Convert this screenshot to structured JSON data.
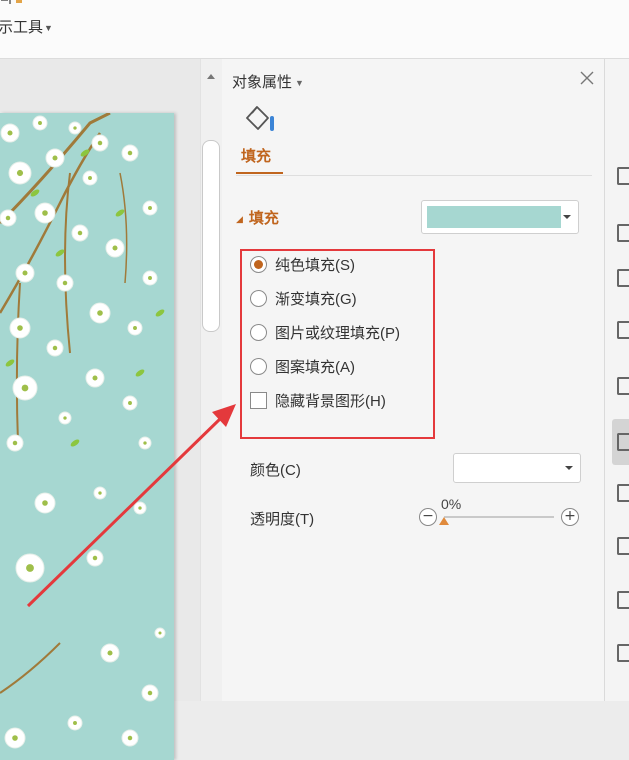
{
  "ribbon": {
    "tool_label": "示工具"
  },
  "panel": {
    "title": "对象属性",
    "tab_label": "填充",
    "section_label": "填充",
    "fill_color": "#a6d7d1",
    "fill_options": [
      {
        "label": "纯色填充(S)",
        "type": "radio",
        "selected": true
      },
      {
        "label": "渐变填充(G)",
        "type": "radio",
        "selected": false
      },
      {
        "label": "图片或纹理填充(P)",
        "type": "radio",
        "selected": false
      },
      {
        "label": "图案填充(A)",
        "type": "radio",
        "selected": false
      },
      {
        "label": "隐藏背景图形(H)",
        "type": "checkbox",
        "checked": false
      }
    ],
    "color_label": "颜色(C)",
    "color_value": "",
    "transparency_label": "透明度(T)",
    "transparency_value": "0%",
    "transparency_fraction": 0
  },
  "colors": {
    "accent": "#c0651e",
    "highlight_box": "#e4393c",
    "slide_background": "#a6d7d1"
  },
  "icons": [
    "fill-bucket-icon",
    "close-icon",
    "minus-icon",
    "plus-icon",
    "caret-down-icon"
  ]
}
